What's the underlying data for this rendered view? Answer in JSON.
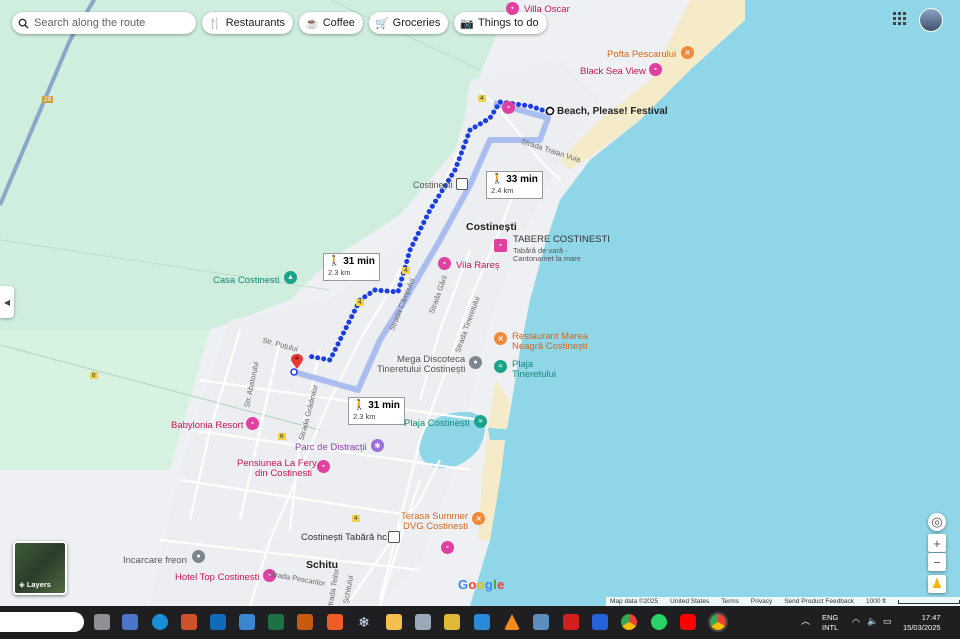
{
  "search": {
    "placeholder": "Search along the route"
  },
  "chips": [
    {
      "icon": "fork-knife-icon",
      "label": "Restaurants"
    },
    {
      "icon": "coffee-cup-icon",
      "label": "Coffee"
    },
    {
      "icon": "cart-icon",
      "label": "Groceries"
    },
    {
      "icon": "camera-icon",
      "label": "Things to do"
    }
  ],
  "destination": {
    "label": "Beach, Please! Festival"
  },
  "routes": [
    {
      "time": "33 min",
      "distance": "2.4 km"
    },
    {
      "time": "31 min",
      "distance": "2.3 km"
    },
    {
      "time": "31 min",
      "distance": "2.3 km"
    }
  ],
  "places": {
    "villa_oscar": "Villa Oscar",
    "pofta_pescarului": "Pofta Pescarului",
    "black_sea_view": "Black Sea View",
    "costinesti_station": "Costinești",
    "costinesti_town": "Costinești",
    "tabere_title": "TABERE COSTINESTI",
    "tabere_sub1": "Tabără de vară -",
    "tabere_sub2": "Cantonamet la mare",
    "vila_rares": "Vila Rareș",
    "casa_costinesti": "Casa Costinesti",
    "restaurant_marea1": "Restaurant Marea",
    "restaurant_marea2": "Neagră Costinești",
    "mega_disco1": "Mega Discoteca",
    "mega_disco2": "Tineretului Costinești",
    "plaja_tineretului1": "Plaja",
    "plaja_tineretului2": "Tineretului",
    "plaja_costinesti": "Plaja Costinești",
    "babylonia": "Babylonia Resort",
    "parc": "Parc de Distracții",
    "pensiunea1": "Pensiunea La Fery",
    "pensiunea2": "din Costinesti",
    "terasa1": "Terasa Summer",
    "terasa2": "DVG Costinesti",
    "tabara_hc": "Costinești Tabără hc.",
    "incarcare": "Incarcare freon",
    "hotel_top": "Hotel Top Costinesti",
    "schitu": "Schitu"
  },
  "roads": {
    "traian_vuia": "Strada Traian Vuia",
    "campului": "Strada Câmpului",
    "gării": "Strada Gării",
    "tineretului": "Strada Tineretului",
    "abatorului": "Str. Abatorului",
    "putului": "Str. Puțului",
    "gradinilor": "Strada Grădinilor",
    "pescarilor": "Strada Pescarilor",
    "teilor": "Strada Teilor",
    "schitului": "Schitului"
  },
  "road_numbers": [
    "29",
    "4",
    "4",
    "4",
    "6",
    "8",
    "4"
  ],
  "controls": {
    "layers": "Layers",
    "zoom_in": "+",
    "zoom_out": "−"
  },
  "attribution": {
    "map_data": "Map data ©2025",
    "country": "United States",
    "terms": "Terms",
    "privacy": "Privacy",
    "feedback": "Send Product Feedback",
    "scale": "1000 ft"
  },
  "google_logo": "Google",
  "taskbar": {
    "lang1": "ENG",
    "lang2": "INTL",
    "time": "17:47",
    "date": "15/03/2025"
  }
}
